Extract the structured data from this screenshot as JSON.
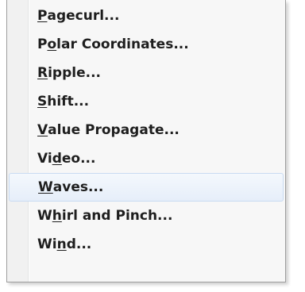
{
  "menu": {
    "items": [
      {
        "pre": "",
        "mn": "P",
        "post": "agecurl..."
      },
      {
        "pre": "P",
        "mn": "o",
        "post": "lar Coordinates..."
      },
      {
        "pre": "",
        "mn": "R",
        "post": "ipple..."
      },
      {
        "pre": "",
        "mn": "S",
        "post": "hift..."
      },
      {
        "pre": "",
        "mn": "V",
        "post": "alue Propagate..."
      },
      {
        "pre": "Vi",
        "mn": "d",
        "post": "eo..."
      },
      {
        "pre": "",
        "mn": "W",
        "post": "aves..."
      },
      {
        "pre": "W",
        "mn": "h",
        "post": "irl and Pinch..."
      },
      {
        "pre": "Wi",
        "mn": "n",
        "post": "d..."
      }
    ],
    "hovered_index": 6,
    "colors": {
      "hover_background": "#e6eef9",
      "hover_border": "#c9dbf2",
      "text": "#1e1e1e"
    }
  }
}
